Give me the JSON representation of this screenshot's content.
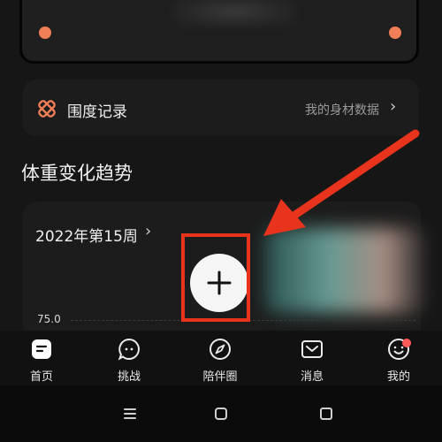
{
  "top_card": {
    "blurred": true
  },
  "measurements_row": {
    "title": "围度记录",
    "link_text": "我的身材数据",
    "chevron": "›"
  },
  "section_title": "体重变化趋势",
  "chart_card": {
    "week_label": "2022年第15周",
    "chevron": "›",
    "y_tick": "75.0"
  },
  "add_button": {
    "icon": "plus-icon"
  },
  "annotation": {
    "color": "#e8341c"
  },
  "tabs": [
    {
      "label": "首页",
      "icon": "home-icon"
    },
    {
      "label": "挑战",
      "icon": "chat-bubble-icon"
    },
    {
      "label": "陪伴圈",
      "icon": "compass-icon"
    },
    {
      "label": "消息",
      "icon": "mail-icon"
    },
    {
      "label": "我的",
      "icon": "smile-face-icon"
    }
  ],
  "colors": {
    "accent": "#f07e57",
    "background": "#161616",
    "card": "#1c1c1c"
  }
}
